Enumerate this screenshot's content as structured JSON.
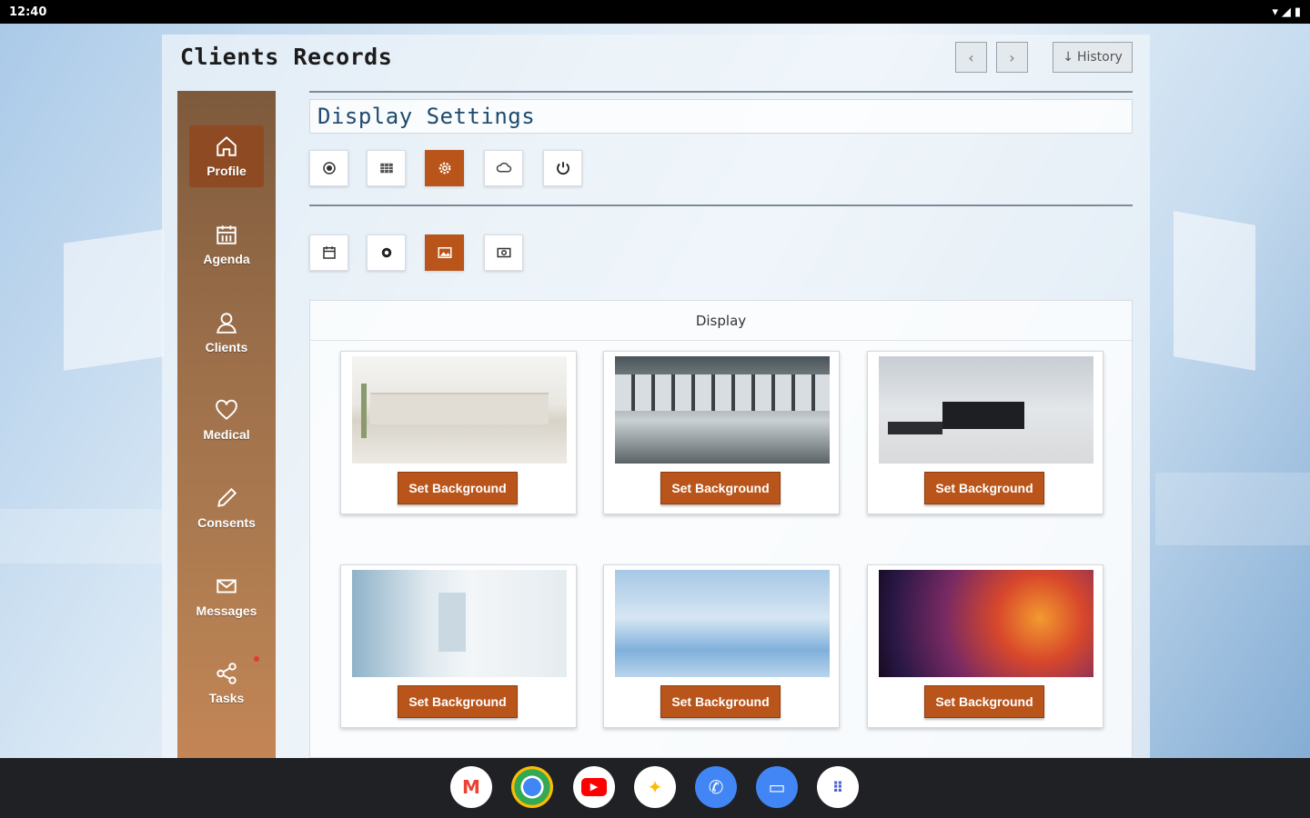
{
  "statusbar": {
    "time": "12:40"
  },
  "app": {
    "title": "Clients Records",
    "nav": {
      "prev_label": "‹",
      "next_label": "›",
      "history_label": "History"
    }
  },
  "sidebar": {
    "items": [
      {
        "label": "Profile",
        "icon": "home-icon",
        "active": true
      },
      {
        "label": "Agenda",
        "icon": "calendar-icon",
        "active": false
      },
      {
        "label": "Clients",
        "icon": "clients-icon",
        "active": false
      },
      {
        "label": "Medical",
        "icon": "heart-icon",
        "active": false
      },
      {
        "label": "Consents",
        "icon": "pencil-icon",
        "active": false
      },
      {
        "label": "Messages",
        "icon": "mail-icon",
        "active": false
      },
      {
        "label": "Tasks",
        "icon": "share-icon",
        "active": false
      }
    ]
  },
  "settings": {
    "section_title": "Display Settings",
    "tabs_row1": [
      {
        "icon": "record-icon",
        "active": false
      },
      {
        "icon": "grid-icon",
        "active": false
      },
      {
        "icon": "gear-icon",
        "active": true
      },
      {
        "icon": "cloud-icon",
        "active": false
      },
      {
        "icon": "power-icon",
        "active": false
      }
    ],
    "tabs_row2": [
      {
        "icon": "calendar-small-icon",
        "active": false
      },
      {
        "icon": "cog-icon",
        "active": false
      },
      {
        "icon": "image-icon",
        "active": true
      },
      {
        "icon": "money-icon",
        "active": false
      }
    ]
  },
  "display": {
    "title": "Display",
    "cards": [
      {
        "scene": "white-lobby",
        "button": "Set Background"
      },
      {
        "scene": "glass-office",
        "button": "Set Background"
      },
      {
        "scene": "reception",
        "button": "Set Background"
      },
      {
        "scene": "corridor",
        "button": "Set Background"
      },
      {
        "scene": "blue-room",
        "button": "Set Background"
      },
      {
        "scene": "abstract-fire",
        "button": "Set Background"
      }
    ]
  },
  "dock": {
    "apps": [
      "gmail-icon",
      "chrome-icon",
      "youtube-icon",
      "photos-icon",
      "phone-icon",
      "messages-icon",
      "apps-grid-icon"
    ]
  }
}
